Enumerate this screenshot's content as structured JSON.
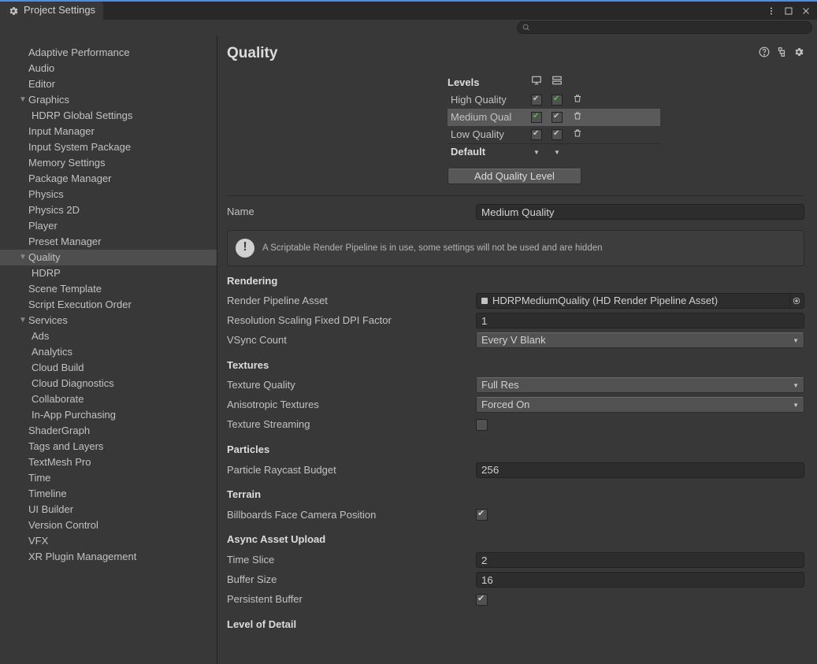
{
  "window": {
    "title": "Project Settings"
  },
  "sidebar": {
    "items": [
      {
        "label": "Adaptive Performance",
        "level": 1,
        "arrow": ""
      },
      {
        "label": "Audio",
        "level": 1,
        "arrow": ""
      },
      {
        "label": "Editor",
        "level": 1,
        "arrow": ""
      },
      {
        "label": "Graphics",
        "level": 1,
        "arrow": "▼"
      },
      {
        "label": "HDRP Global Settings",
        "level": 2,
        "arrow": ""
      },
      {
        "label": "Input Manager",
        "level": 1,
        "arrow": ""
      },
      {
        "label": "Input System Package",
        "level": 1,
        "arrow": ""
      },
      {
        "label": "Memory Settings",
        "level": 1,
        "arrow": ""
      },
      {
        "label": "Package Manager",
        "level": 1,
        "arrow": ""
      },
      {
        "label": "Physics",
        "level": 1,
        "arrow": ""
      },
      {
        "label": "Physics 2D",
        "level": 1,
        "arrow": ""
      },
      {
        "label": "Player",
        "level": 1,
        "arrow": ""
      },
      {
        "label": "Preset Manager",
        "level": 1,
        "arrow": ""
      },
      {
        "label": "Quality",
        "level": 1,
        "arrow": "▼",
        "selected": true
      },
      {
        "label": "HDRP",
        "level": 2,
        "arrow": ""
      },
      {
        "label": "Scene Template",
        "level": 1,
        "arrow": ""
      },
      {
        "label": "Script Execution Order",
        "level": 1,
        "arrow": ""
      },
      {
        "label": "Services",
        "level": 1,
        "arrow": "▼"
      },
      {
        "label": "Ads",
        "level": 2,
        "arrow": ""
      },
      {
        "label": "Analytics",
        "level": 2,
        "arrow": ""
      },
      {
        "label": "Cloud Build",
        "level": 2,
        "arrow": ""
      },
      {
        "label": "Cloud Diagnostics",
        "level": 2,
        "arrow": ""
      },
      {
        "label": "Collaborate",
        "level": 2,
        "arrow": ""
      },
      {
        "label": "In-App Purchasing",
        "level": 2,
        "arrow": ""
      },
      {
        "label": "ShaderGraph",
        "level": 1,
        "arrow": ""
      },
      {
        "label": "Tags and Layers",
        "level": 1,
        "arrow": ""
      },
      {
        "label": "TextMesh Pro",
        "level": 1,
        "arrow": ""
      },
      {
        "label": "Time",
        "level": 1,
        "arrow": ""
      },
      {
        "label": "Timeline",
        "level": 1,
        "arrow": ""
      },
      {
        "label": "UI Builder",
        "level": 1,
        "arrow": ""
      },
      {
        "label": "Version Control",
        "level": 1,
        "arrow": ""
      },
      {
        "label": "VFX",
        "level": 1,
        "arrow": ""
      },
      {
        "label": "XR Plugin Management",
        "level": 1,
        "arrow": ""
      }
    ]
  },
  "quality": {
    "title": "Quality",
    "levels_header": {
      "title": "Levels"
    },
    "levels": [
      {
        "label": "High Quality",
        "col1": "grey",
        "col2": "green",
        "selected": false
      },
      {
        "label": "Medium Qual",
        "col1": "green",
        "col2": "grey",
        "selected": true
      },
      {
        "label": "Low Quality",
        "col1": "grey",
        "col2": "grey",
        "selected": false
      }
    ],
    "default_label": "Default",
    "add_level": "Add Quality Level",
    "name_label": "Name",
    "name_value": "Medium Quality",
    "info_msg": "A Scriptable Render Pipeline is in use, some settings will not be used and are hidden",
    "sections": {
      "rendering": {
        "title": "Rendering",
        "rp_label": "Render Pipeline Asset",
        "rp_value": "HDRPMediumQuality (HD Render Pipeline Asset)",
        "dpi_label": "Resolution Scaling Fixed DPI Factor",
        "dpi_value": "1",
        "vsync_label": "VSync Count",
        "vsync_value": "Every V Blank"
      },
      "textures": {
        "title": "Textures",
        "tq_label": "Texture Quality",
        "tq_value": "Full Res",
        "aniso_label": "Anisotropic Textures",
        "aniso_value": "Forced On",
        "stream_label": "Texture Streaming",
        "stream_checked": false
      },
      "particles": {
        "title": "Particles",
        "ray_label": "Particle Raycast Budget",
        "ray_value": "256"
      },
      "terrain": {
        "title": "Terrain",
        "bb_label": "Billboards Face Camera Position",
        "bb_checked": true
      },
      "async": {
        "title": "Async Asset Upload",
        "ts_label": "Time Slice",
        "ts_value": "2",
        "bs_label": "Buffer Size",
        "bs_value": "16",
        "pb_label": "Persistent Buffer",
        "pb_checked": true
      },
      "lod": {
        "title": "Level of Detail"
      }
    }
  }
}
